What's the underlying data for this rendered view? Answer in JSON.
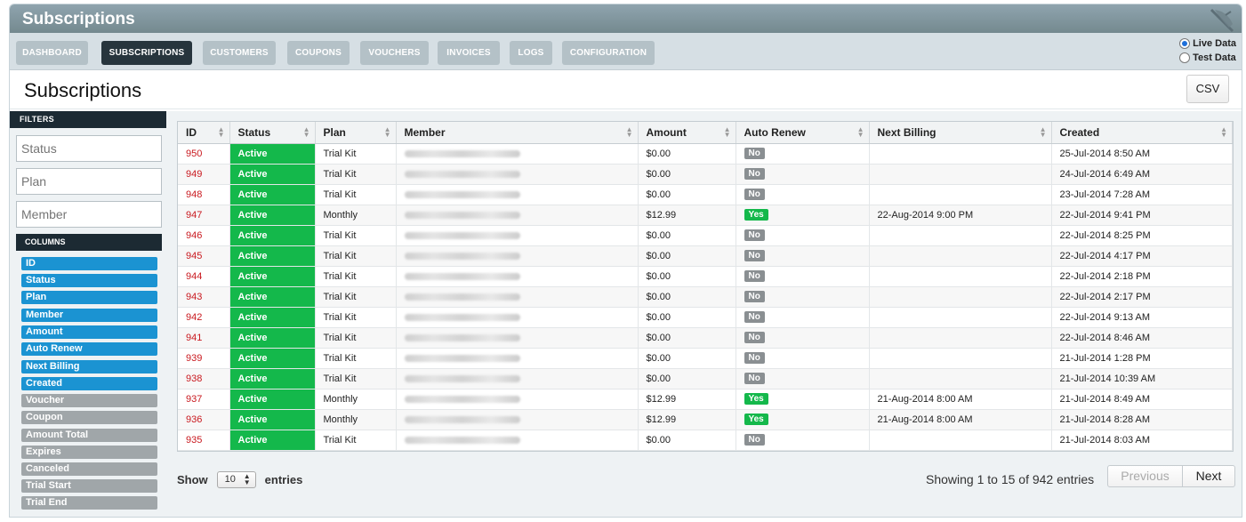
{
  "app_title": "Subscriptions",
  "nav": {
    "items": [
      {
        "label": "DASHBOARD"
      },
      {
        "label": "SUBSCRIPTIONS"
      },
      {
        "label": "CUSTOMERS"
      },
      {
        "label": "COUPONS"
      },
      {
        "label": "VOUCHERS"
      },
      {
        "label": "INVOICES"
      },
      {
        "label": "LOGS"
      },
      {
        "label": "CONFIGURATION"
      }
    ],
    "active": "SUBSCRIPTIONS"
  },
  "data_mode": {
    "options": [
      {
        "label": "Live Data",
        "selected": true
      },
      {
        "label": "Test Data",
        "selected": false
      }
    ]
  },
  "page_title": "Subscriptions",
  "csv_label": "CSV",
  "filters": {
    "heading": "FILTERS",
    "placeholders": [
      "Status",
      "Plan",
      "Member"
    ]
  },
  "columns": {
    "heading": "COLUMNS",
    "items": [
      {
        "label": "ID",
        "visible": true
      },
      {
        "label": "Status",
        "visible": true
      },
      {
        "label": "Plan",
        "visible": true
      },
      {
        "label": "Member",
        "visible": true
      },
      {
        "label": "Amount",
        "visible": true
      },
      {
        "label": "Auto Renew",
        "visible": true
      },
      {
        "label": "Next Billing",
        "visible": true
      },
      {
        "label": "Created",
        "visible": true
      },
      {
        "label": "Voucher",
        "visible": false
      },
      {
        "label": "Coupon",
        "visible": false
      },
      {
        "label": "Amount Total",
        "visible": false
      },
      {
        "label": "Expires",
        "visible": false
      },
      {
        "label": "Canceled",
        "visible": false
      },
      {
        "label": "Trial Start",
        "visible": false
      },
      {
        "label": "Trial End",
        "visible": false
      }
    ]
  },
  "table": {
    "headers": [
      "ID",
      "Status",
      "Plan",
      "Member",
      "Amount",
      "Auto Renew",
      "Next Billing",
      "Created"
    ],
    "rows": [
      {
        "id": "950",
        "status": "Active",
        "plan": "Trial Kit",
        "amount": "$0.00",
        "auto_renew": "No",
        "next_billing": "",
        "created": "25-Jul-2014 8:50 AM"
      },
      {
        "id": "949",
        "status": "Active",
        "plan": "Trial Kit",
        "amount": "$0.00",
        "auto_renew": "No",
        "next_billing": "",
        "created": "24-Jul-2014 6:49 AM"
      },
      {
        "id": "948",
        "status": "Active",
        "plan": "Trial Kit",
        "amount": "$0.00",
        "auto_renew": "No",
        "next_billing": "",
        "created": "23-Jul-2014 7:28 AM"
      },
      {
        "id": "947",
        "status": "Active",
        "plan": "Monthly",
        "amount": "$12.99",
        "auto_renew": "Yes",
        "next_billing": "22-Aug-2014 9:00 PM",
        "created": "22-Jul-2014 9:41 PM"
      },
      {
        "id": "946",
        "status": "Active",
        "plan": "Trial Kit",
        "amount": "$0.00",
        "auto_renew": "No",
        "next_billing": "",
        "created": "22-Jul-2014 8:25 PM"
      },
      {
        "id": "945",
        "status": "Active",
        "plan": "Trial Kit",
        "amount": "$0.00",
        "auto_renew": "No",
        "next_billing": "",
        "created": "22-Jul-2014 4:17 PM"
      },
      {
        "id": "944",
        "status": "Active",
        "plan": "Trial Kit",
        "amount": "$0.00",
        "auto_renew": "No",
        "next_billing": "",
        "created": "22-Jul-2014 2:18 PM"
      },
      {
        "id": "943",
        "status": "Active",
        "plan": "Trial Kit",
        "amount": "$0.00",
        "auto_renew": "No",
        "next_billing": "",
        "created": "22-Jul-2014 2:17 PM"
      },
      {
        "id": "942",
        "status": "Active",
        "plan": "Trial Kit",
        "amount": "$0.00",
        "auto_renew": "No",
        "next_billing": "",
        "created": "22-Jul-2014 9:13 AM"
      },
      {
        "id": "941",
        "status": "Active",
        "plan": "Trial Kit",
        "amount": "$0.00",
        "auto_renew": "No",
        "next_billing": "",
        "created": "22-Jul-2014 8:46 AM"
      },
      {
        "id": "939",
        "status": "Active",
        "plan": "Trial Kit",
        "amount": "$0.00",
        "auto_renew": "No",
        "next_billing": "",
        "created": "21-Jul-2014 1:28 PM"
      },
      {
        "id": "938",
        "status": "Active",
        "plan": "Trial Kit",
        "amount": "$0.00",
        "auto_renew": "No",
        "next_billing": "",
        "created": "21-Jul-2014 10:39 AM"
      },
      {
        "id": "937",
        "status": "Active",
        "plan": "Monthly",
        "amount": "$12.99",
        "auto_renew": "Yes",
        "next_billing": "21-Aug-2014 8:00 AM",
        "created": "21-Jul-2014 8:49 AM"
      },
      {
        "id": "936",
        "status": "Active",
        "plan": "Monthly",
        "amount": "$12.99",
        "auto_renew": "Yes",
        "next_billing": "21-Aug-2014 8:00 AM",
        "created": "21-Jul-2014 8:28 AM"
      },
      {
        "id": "935",
        "status": "Active",
        "plan": "Trial Kit",
        "amount": "$0.00",
        "auto_renew": "No",
        "next_billing": "",
        "created": "21-Jul-2014 8:03 AM"
      }
    ]
  },
  "footer": {
    "show_label": "Show",
    "entries_value": "10",
    "entries_label": "entries",
    "showing_text": "Showing 1 to 15 of 942 entries",
    "previous_label": "Previous",
    "next_label": "Next"
  },
  "colors": {
    "active_green": "#14b84b",
    "id_red": "#c9191f",
    "column_on_blue": "#1b93d2",
    "nav_active": "#27353d"
  }
}
